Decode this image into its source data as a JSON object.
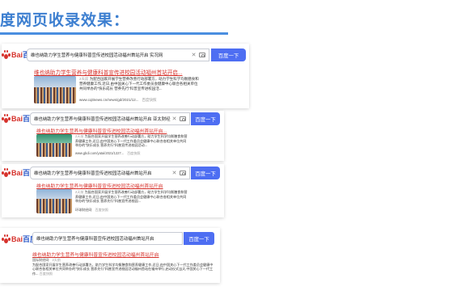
{
  "page": {
    "title": "度网页收录效果："
  },
  "results": [
    {
      "query": "维也纳助力学生营养与健康科普宣传进校园活动福州首站开启 实况网",
      "button": "百度一下",
      "result_title": "维也纳助力学生营养与健康科普宣传进校园活动福州首站开启...",
      "date": "2天前",
      "snippet": "为配合国家开展学生营养改善行动部署方，助力学生科学均衡膳食和营养健康工作,近日,由中国关心下一代工作委员会健康中心联合各相关单位共同举办的“快乐成长 营养先行”科普宣传进校园活...",
      "url": "www.cqitnews.cn/news/gd/2021/12...",
      "snapshot": "百度快照"
    },
    {
      "query": "维也纳助力学生营养与健康科普宣传进校园活动福州首站开启 亚太财经",
      "button": "百度一下",
      "result_title": "维也纳助力学生营养与健康科普宣传进校园活动福州首站开启...",
      "date": "2天前",
      "snippet": "为配合国家开展学生营养改善行动部署方，助力学生科学均衡膳食和营养健康工作,近日,由中国关心下一代工作委员会健康中心联合各相关单位共同举办的“快乐成长 营养先行”科普宣传进校园活动...",
      "url": "www.gbdi.com/yatai/2021/1227...",
      "snapshot": "百度快照"
    },
    {
      "query": "维也纳助力学生营养与健康科普宣传进校园活动福州首站开启",
      "button": "百度一下",
      "result_title": "维也纳助力学生营养与健康科普宣传进校园活动福州首站开启",
      "date": "2天前",
      "snippet": "为配合国家开展学生营养改善行动部署方，助力学生科学均衡膳食和营养健康工作,近日,由中国关心下一代工作委员会健康中心联合各相关单位共同举办的“快乐成长 营养先行”科普宣传进校园...",
      "url": "环球财经网",
      "snapshot": "百度快照"
    },
    {
      "query": "维也纳助力学生营养与健康科普宣传进校园活动福州首站开启",
      "button": "百度一下",
      "result_title": "维也纳助力学生营养与健康科普宣传进校园活动福州首站开启",
      "source": "国际财经网",
      "date": "2天前",
      "snippet": "为配合国家开展学生营养改善行动部署方，助力学生科学均衡膳食和营养健康工作,近日,由中国关心下一代工作委员会健康中心联合各相关单位共同举办的“快乐成长 营养先行”科普宣传进校园活动福州首站在福州举行,启动仪式当天,中国关心下一代工作...",
      "url": "",
      "snapshot": "百度快照"
    }
  ],
  "logo": {
    "text_bai": "Bai",
    "text_du": "百度"
  },
  "colors": {
    "accent": "#4e6ef2",
    "title": "#3d7fd0",
    "link": "#d6322c"
  }
}
